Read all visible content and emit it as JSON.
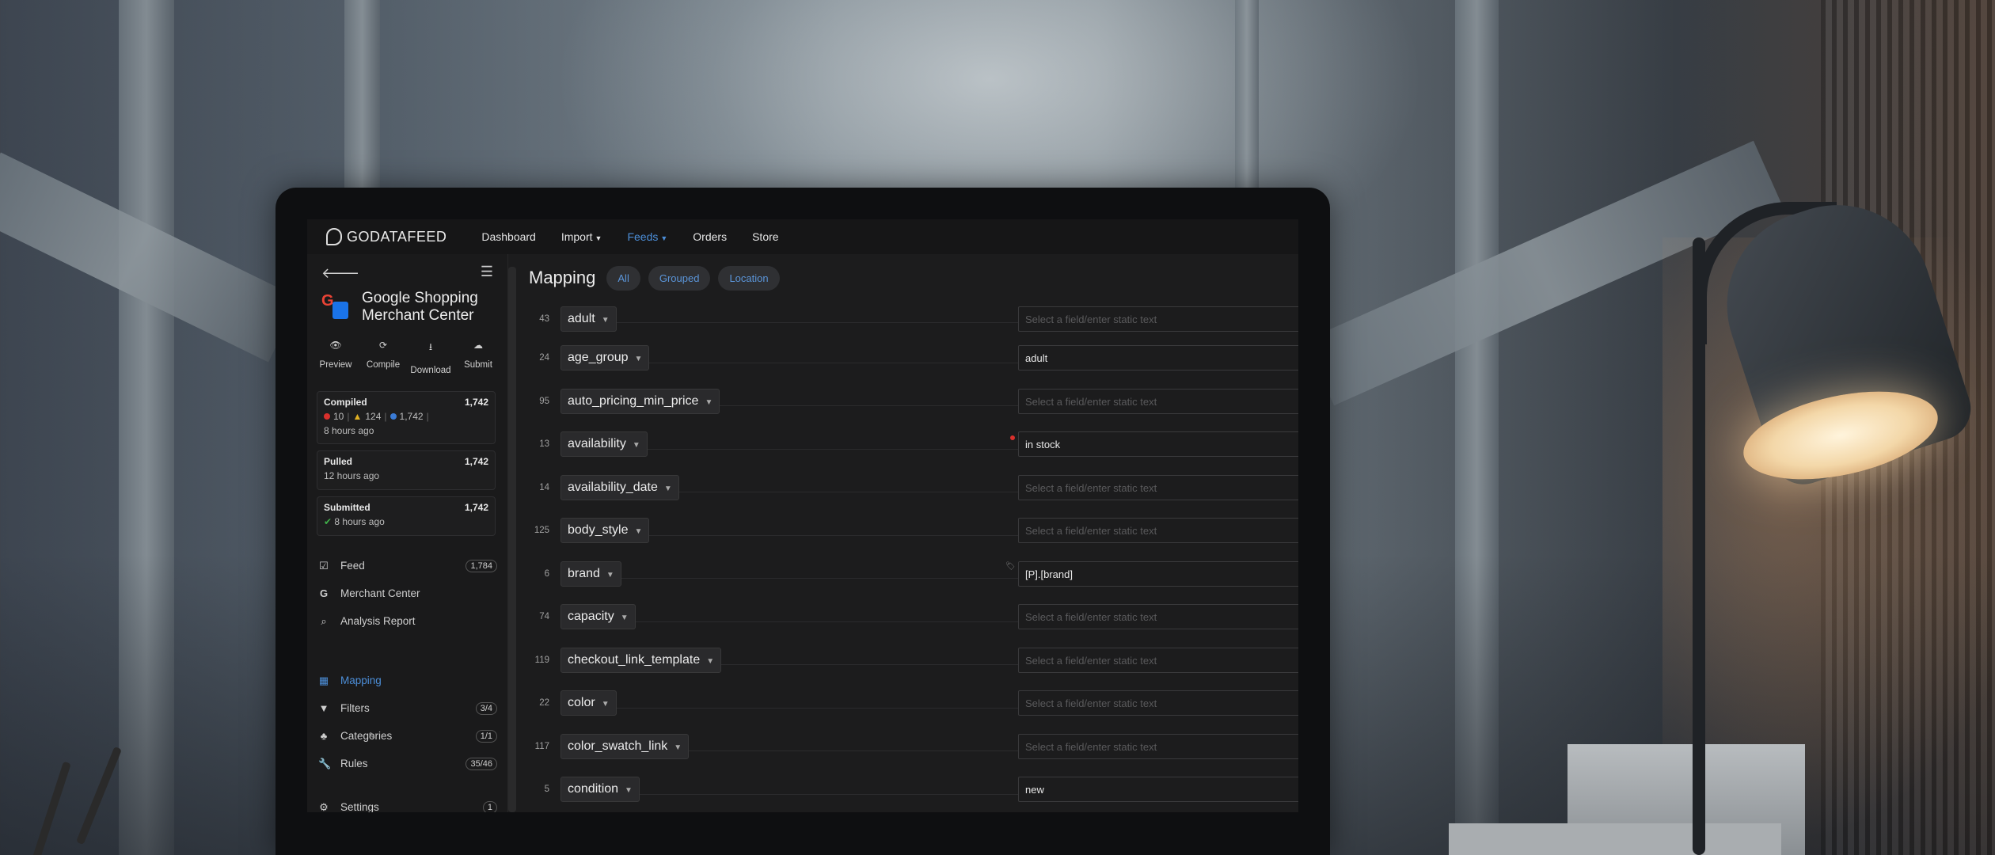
{
  "app": {
    "logo_text": "GODATAFEED",
    "nav": [
      {
        "label": "Dashboard",
        "dropdown": false,
        "active": false
      },
      {
        "label": "Import",
        "dropdown": true,
        "active": false
      },
      {
        "label": "Feeds",
        "dropdown": true,
        "active": true
      },
      {
        "label": "Orders",
        "dropdown": false,
        "active": false
      },
      {
        "label": "Store",
        "dropdown": false,
        "active": false
      }
    ]
  },
  "sidebar": {
    "feed_title": "Google Shopping Merchant Center",
    "actions": [
      {
        "label": "Preview",
        "icon": "eye-icon"
      },
      {
        "label": "Compile",
        "icon": "refresh-icon"
      },
      {
        "label": "Download",
        "icon": "download-icon"
      },
      {
        "label": "Submit",
        "icon": "cloud-upload-icon"
      }
    ],
    "compiled": {
      "title": "Compiled",
      "count": "1,742",
      "errors": "10",
      "warnings": "124",
      "info": "1,742",
      "time": "8 hours ago"
    },
    "pulled": {
      "title": "Pulled",
      "count": "1,742",
      "time": "12 hours ago"
    },
    "submitted": {
      "title": "Submitted",
      "count": "1,742",
      "time": "8 hours ago"
    },
    "menu": [
      {
        "label": "Feed",
        "icon": "checkbox-icon",
        "count": "1,784",
        "active": false
      },
      {
        "label": "Merchant Center",
        "icon": "google-icon",
        "count": "",
        "active": false
      },
      {
        "label": "Analysis Report",
        "icon": "search-icon",
        "count": "",
        "active": false
      },
      {
        "label": "Mapping",
        "icon": "map-icon",
        "count": "",
        "active": true
      },
      {
        "label": "Filters",
        "icon": "filter-icon",
        "count": "3/4",
        "active": false
      },
      {
        "label": "Categories",
        "icon": "tree-icon",
        "count": "1/1",
        "active": false
      },
      {
        "label": "Rules",
        "icon": "wrench-icon",
        "count": "35/46",
        "active": false
      },
      {
        "label": "Settings",
        "icon": "gears-icon",
        "count": "1",
        "active": false
      }
    ]
  },
  "mapping": {
    "title": "Mapping",
    "tabs": [
      "All",
      "Grouped",
      "Location"
    ],
    "placeholder": "Select a field/enter static text",
    "rows": [
      {
        "num": "43",
        "field": "adult",
        "value": ""
      },
      {
        "num": "24",
        "field": "age_group",
        "value": "adult"
      },
      {
        "num": "95",
        "field": "auto_pricing_min_price",
        "value": ""
      },
      {
        "num": "13",
        "field": "availability",
        "value": "in stock"
      },
      {
        "num": "14",
        "field": "availability_date",
        "value": ""
      },
      {
        "num": "125",
        "field": "body_style",
        "value": ""
      },
      {
        "num": "6",
        "field": "brand",
        "value": "[P].[brand]"
      },
      {
        "num": "74",
        "field": "capacity",
        "value": ""
      },
      {
        "num": "119",
        "field": "checkout_link_template",
        "value": ""
      },
      {
        "num": "22",
        "field": "color",
        "value": ""
      },
      {
        "num": "117",
        "field": "color_swatch_link",
        "value": ""
      },
      {
        "num": "5",
        "field": "condition",
        "value": "new"
      }
    ]
  }
}
